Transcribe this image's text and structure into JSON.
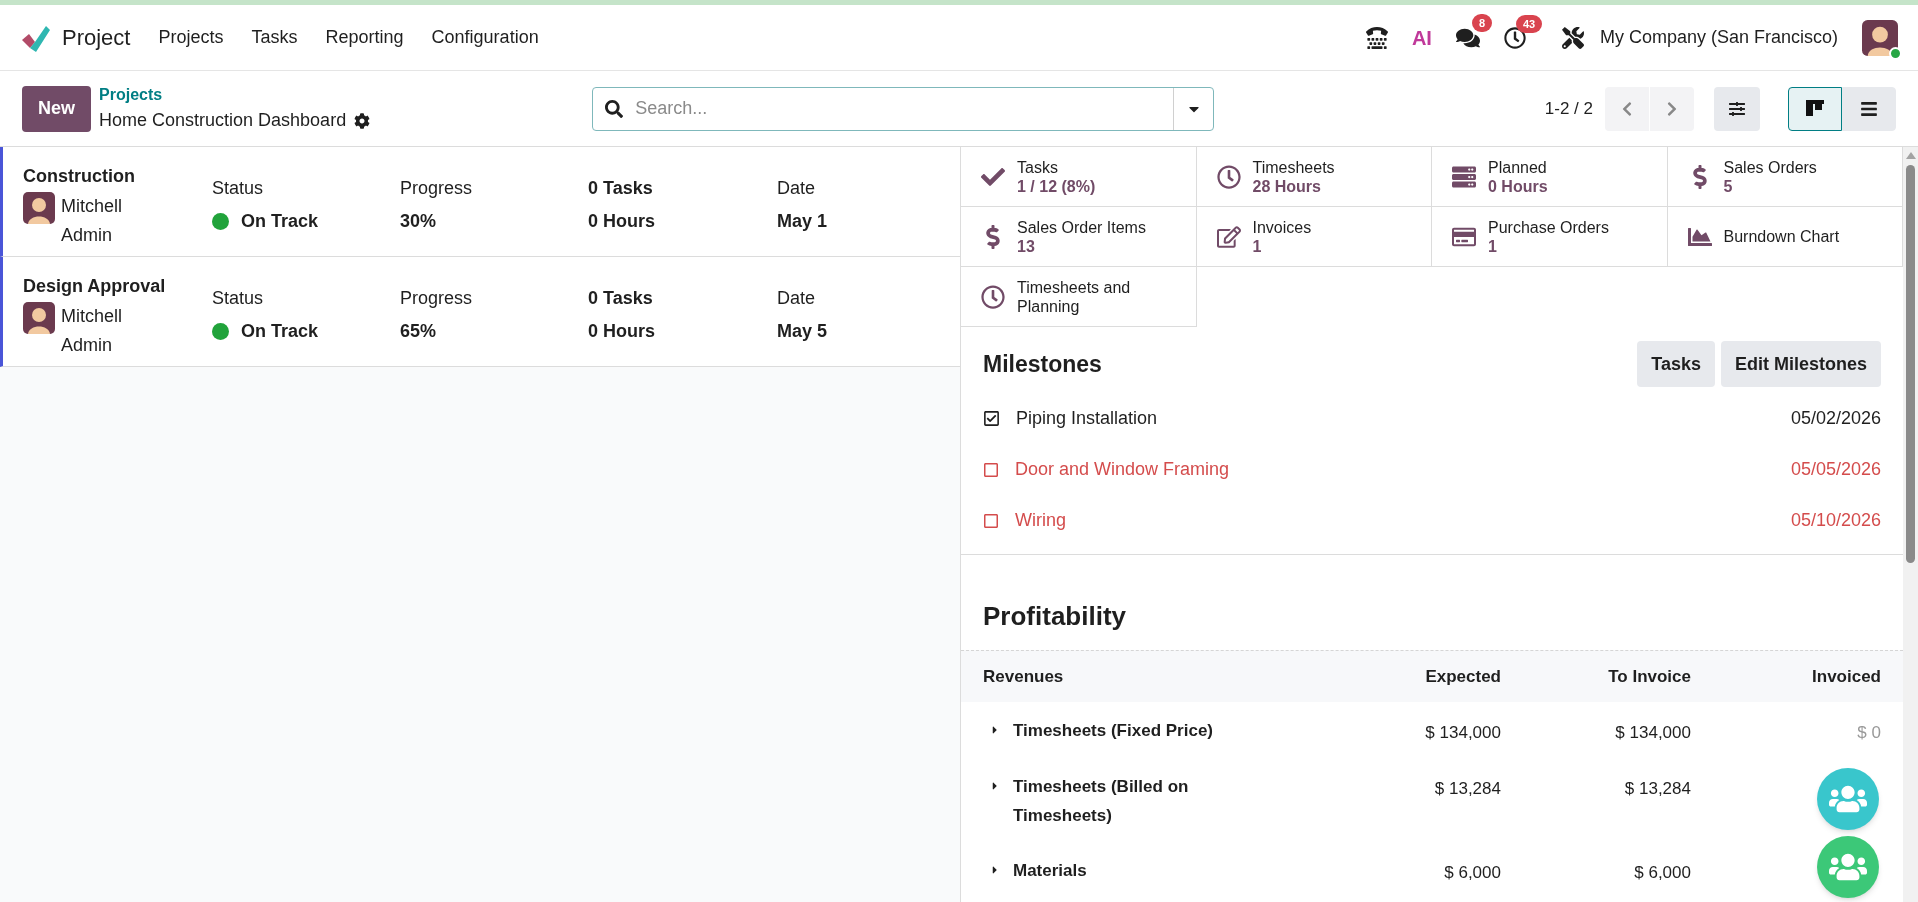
{
  "app": {
    "name": "Project"
  },
  "menu": [
    "Projects",
    "Tasks",
    "Reporting",
    "Configuration"
  ],
  "systray": {
    "ai_label": "AI",
    "messages_badge": "8",
    "activities_badge": "43",
    "company": "My Company (San Francisco)"
  },
  "control_panel": {
    "new_button": "New",
    "breadcrumb": "Projects",
    "title": "Home Construction Dashboard",
    "search": {
      "placeholder": "Search..."
    },
    "pager": "1-2 / 2",
    "views": [
      {
        "kind": "kanban",
        "selected": true
      },
      {
        "kind": "list",
        "selected": false
      }
    ]
  },
  "projects": [
    {
      "name": "Construction",
      "manager": "Mitchell Admin",
      "status_label": "Status",
      "status": "On Track",
      "color": "#21a33b",
      "progress_label": "Progress",
      "progress": "30%",
      "tasks": "0 Tasks",
      "hours": "0 Hours",
      "date_label": "Date",
      "date": "May 1"
    },
    {
      "name": "Design Approval",
      "manager": "Mitchell Admin",
      "status_label": "Status",
      "status": "On Track",
      "color": "#21a33b",
      "progress_label": "Progress",
      "progress": "65%",
      "tasks": "0 Tasks",
      "hours": "0 Hours",
      "date_label": "Date",
      "date": "May 5"
    }
  ],
  "stats": [
    {
      "kind": "check",
      "label": "Tasks",
      "value": "1 / 12 (8%)"
    },
    {
      "kind": "clock",
      "label": "Timesheets",
      "value": "28 Hours"
    },
    {
      "kind": "planned",
      "label": "Planned",
      "value": "0 Hours"
    },
    {
      "kind": "dollar",
      "label": "Sales Orders",
      "value": "5"
    },
    {
      "kind": "dollar",
      "label": "Sales Order Items",
      "value": "13"
    },
    {
      "kind": "edit",
      "label": "Invoices",
      "value": "1"
    },
    {
      "kind": "card",
      "label": "Purchase Orders",
      "value": "1"
    },
    {
      "kind": "chart",
      "label": "Burndown Chart"
    },
    {
      "kind": "clock",
      "label": "Timesheets and Planning"
    }
  ],
  "milestones": {
    "title": "Milestones",
    "buttons": [
      "Tasks",
      "Edit Milestones"
    ],
    "items": [
      {
        "name": "Piping Installation",
        "date": "05/02/2026",
        "checked": true,
        "overdue": false
      },
      {
        "name": "Door and Window Framing",
        "date": "05/05/2026",
        "checked": false,
        "overdue": true
      },
      {
        "name": "Wiring",
        "date": "05/10/2026",
        "checked": false,
        "overdue": true
      }
    ]
  },
  "profitability": {
    "title": "Profitability",
    "columns": [
      "Revenues",
      "Expected",
      "To Invoice",
      "Invoiced"
    ],
    "rows": [
      {
        "label": "Timesheets (Fixed Price)",
        "expected": "$ 134,000",
        "to_invoice": "$ 134,000",
        "invoiced": "$ 0"
      },
      {
        "label": "Timesheets (Billed on Timesheets)",
        "expected": "$ 13,284",
        "to_invoice": "$ 13,284"
      },
      {
        "label": "Materials",
        "expected": "$ 6,000",
        "to_invoice": "$ 6,000"
      }
    ]
  }
}
